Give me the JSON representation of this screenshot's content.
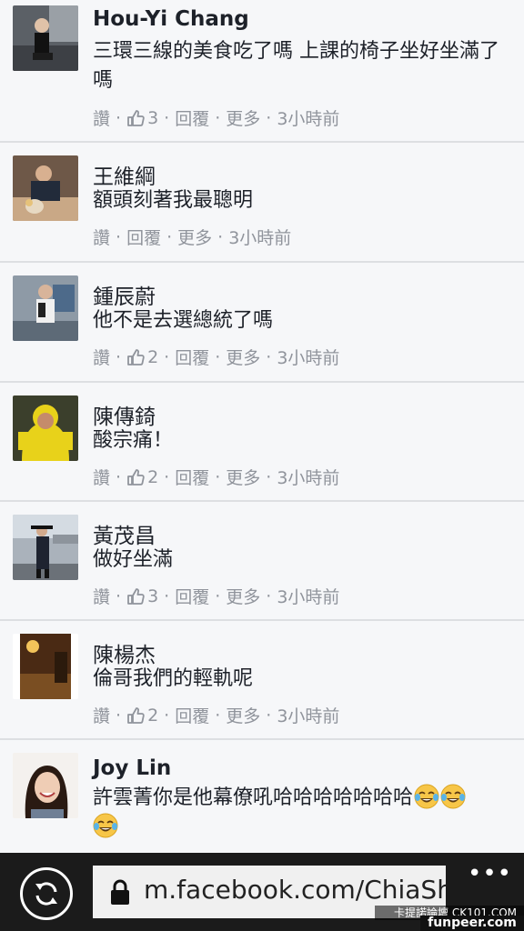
{
  "comments": [
    {
      "name": "Hou-Yi Chang",
      "text": "三環三線的美食吃了嗎 上課的椅子坐好坐滿了嗎",
      "like_label": "讚",
      "likes": "3",
      "reply_label": "回覆",
      "more_label": "更多",
      "time": "3小時前",
      "avatar_icon": "avatar-photo"
    },
    {
      "name": "王維綱",
      "text": "額頭刻著我最聰明",
      "like_label": "讚",
      "likes": "",
      "reply_label": "回覆",
      "more_label": "更多",
      "time": "3小時前",
      "avatar_icon": "avatar-photo"
    },
    {
      "name": "鍾辰蔚",
      "text": "他不是去選總統了嗎",
      "like_label": "讚",
      "likes": "2",
      "reply_label": "回覆",
      "more_label": "更多",
      "time": "3小時前",
      "avatar_icon": "avatar-photo"
    },
    {
      "name": "陳傳錡",
      "text": "酸宗痛！",
      "like_label": "讚",
      "likes": "2",
      "reply_label": "回覆",
      "more_label": "更多",
      "time": "3小時前",
      "avatar_icon": "avatar-photo"
    },
    {
      "name": "黃茂昌",
      "text": "做好坐滿",
      "like_label": "讚",
      "likes": "3",
      "reply_label": "回覆",
      "more_label": "更多",
      "time": "3小時前",
      "avatar_icon": "avatar-photo"
    },
    {
      "name": "陳楊杰",
      "text": "倫哥我們的輕軌呢",
      "like_label": "讚",
      "likes": "2",
      "reply_label": "回覆",
      "more_label": "更多",
      "time": "3小時前",
      "avatar_icon": "avatar-photo"
    },
    {
      "name": "Joy Lin",
      "text": "許雲菁你是他幕僚吼哈哈哈哈哈哈哈",
      "emoji": "laughing-tears-emoji"
    }
  ],
  "browser": {
    "url": "m.facebook.com/ChiaSha",
    "more_label": "•••",
    "refresh_icon": "refresh-icon",
    "lock_icon": "lock-icon"
  },
  "watermark": {
    "line1": "卡提諾論壇 CK101.COM",
    "line2": "funpeer.com"
  },
  "colors": {
    "background": "#f6f7f9",
    "name": "#1d2129",
    "meta": "#90949c",
    "separator": "#dddfe2",
    "bottombar": "#1b1b1b"
  }
}
